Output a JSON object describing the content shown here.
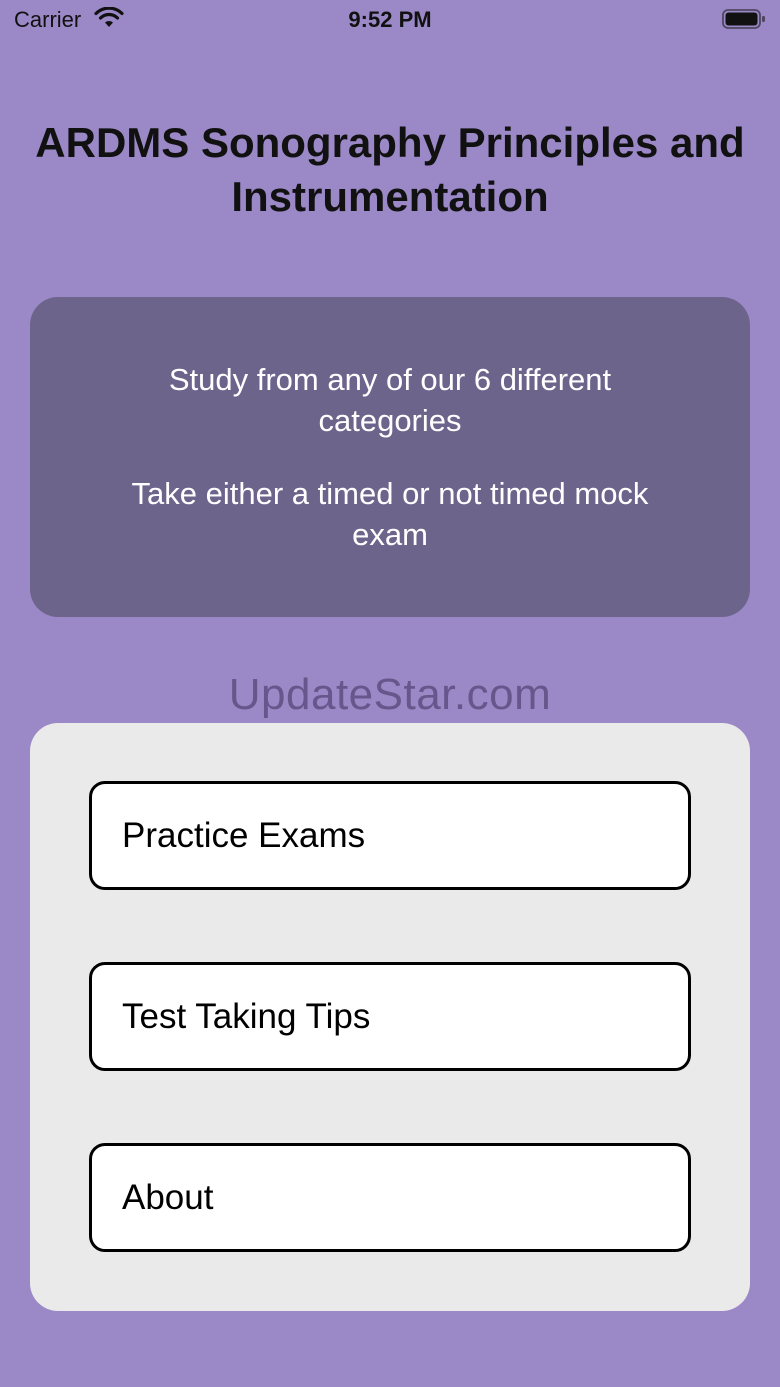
{
  "status_bar": {
    "carrier": "Carrier",
    "time": "9:52 PM",
    "wifi_icon": "wifi-icon",
    "battery_icon": "battery-full-icon"
  },
  "title": "ARDMS Sonography Principles and Instrumentation",
  "info_card": {
    "line1": "Study from any of our 6 different categories",
    "line2": "Take either a timed or not timed mock exam"
  },
  "watermark": "UpdateStar.com",
  "menu": {
    "practice_exams": "Practice Exams",
    "test_taking_tips": "Test Taking Tips",
    "about": "About"
  },
  "colors": {
    "background": "#9b88c6",
    "info_card": "#6d648c",
    "menu_panel": "#eaeaea",
    "button": "#ffffff",
    "button_border": "#000000"
  }
}
